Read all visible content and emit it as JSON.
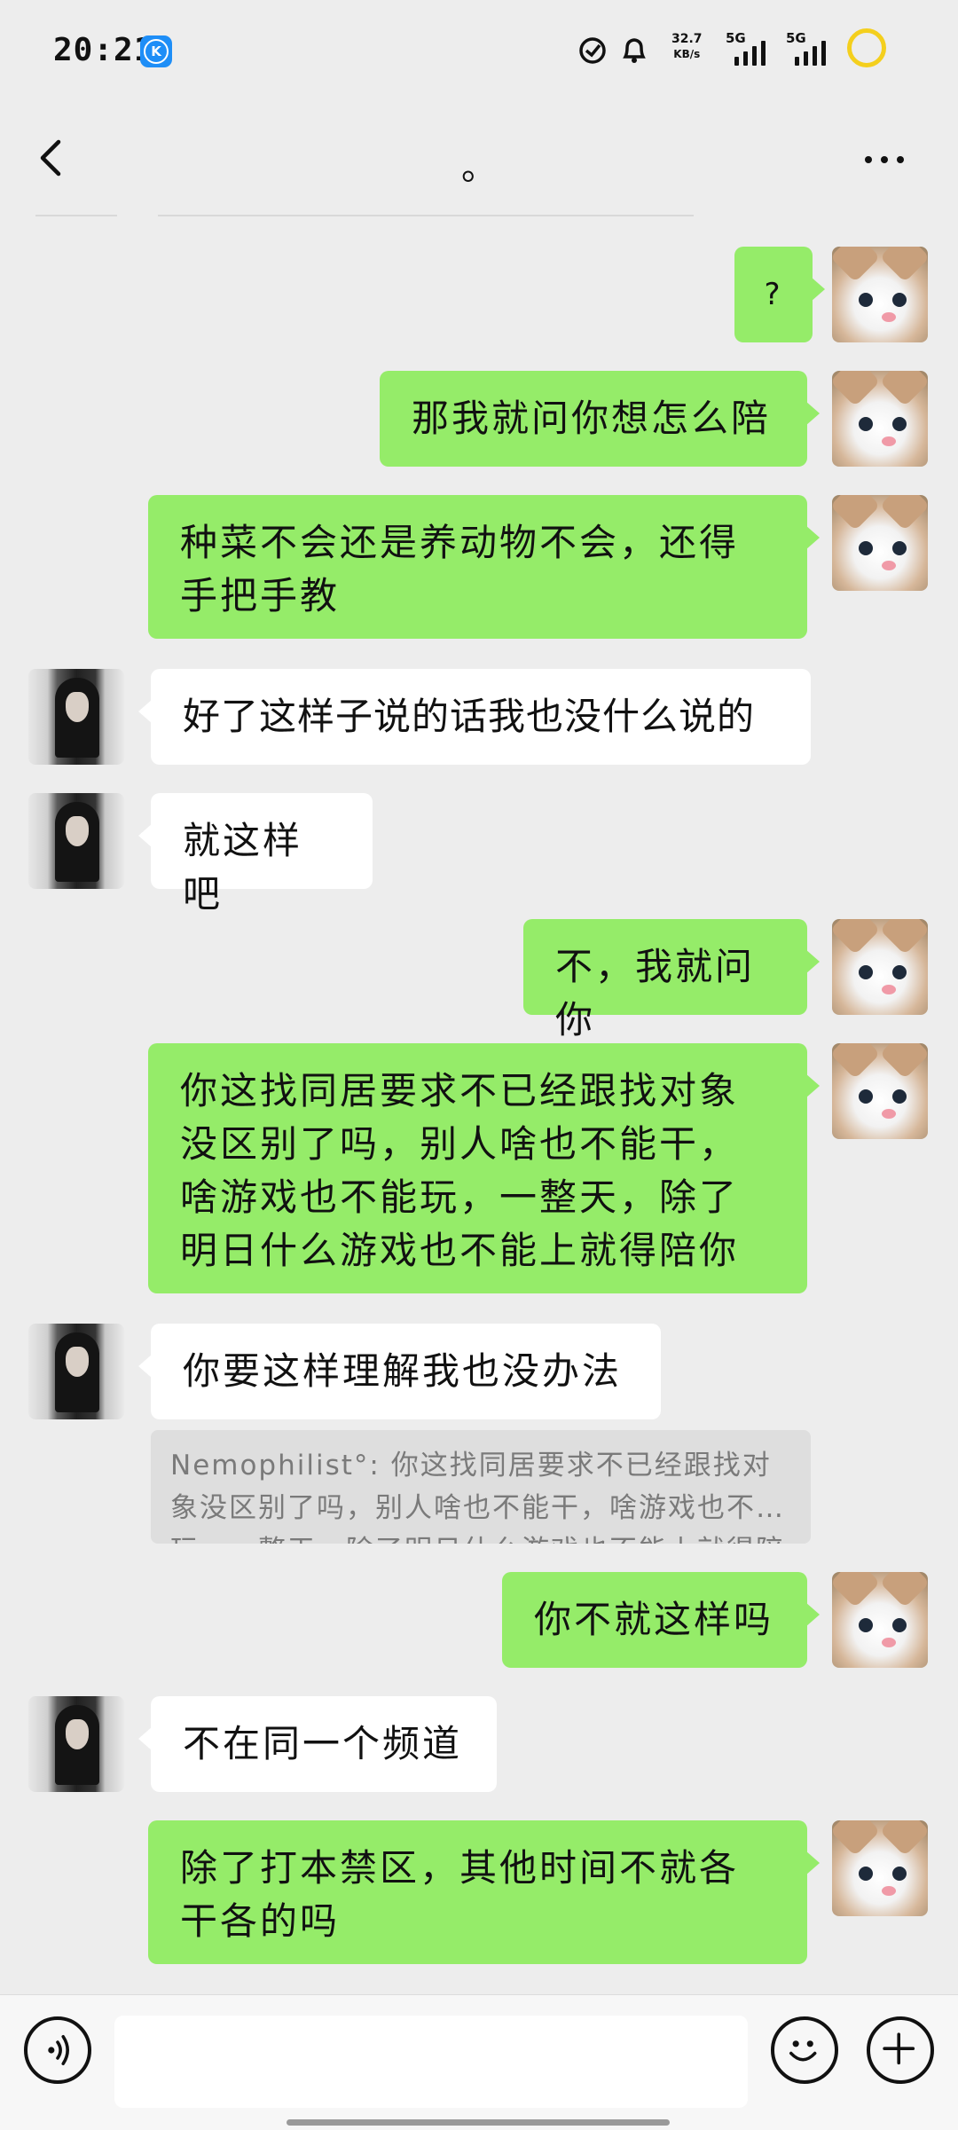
{
  "status_bar": {
    "time": "20:21",
    "app_badge": "K",
    "net_speed_value": "32.7",
    "net_speed_unit": "KB/s",
    "sim1_label": "5G",
    "sim2_label": "5G"
  },
  "header": {
    "title": "。"
  },
  "messages": [
    {
      "from": "self",
      "text": "?"
    },
    {
      "from": "self",
      "text": "那我就问你想怎么陪"
    },
    {
      "from": "self",
      "text": "种菜不会还是养动物不会，还得手把手教"
    },
    {
      "from": "other",
      "text": "好了这样子说的话我也没什么说的"
    },
    {
      "from": "other",
      "text": "就这样吧"
    },
    {
      "from": "self",
      "text": "不，我就问你"
    },
    {
      "from": "self",
      "text": "你这找同居要求不已经跟找对象没区别了吗，别人啥也不能干，啥游戏也不能玩，一整天，除了明日什么游戏也不能上就得陪你"
    },
    {
      "from": "other",
      "text": "你要这样理解我也没办法"
    },
    {
      "from": "self",
      "text": "你不就这样吗"
    },
    {
      "from": "other",
      "text": "不在同一个频道"
    },
    {
      "from": "self",
      "text": "除了打本禁区，其他时间不就各干各的吗"
    }
  ],
  "quote": {
    "text": "Nemophilist°: 你这找同居要求不已经跟找对象没区别了吗，别人啥也不能干，啥游戏也不能玩，一整天，除了明日什么游戏也不能上就得陪你"
  },
  "input_bar": {
    "placeholder": "",
    "voice_icon": "voice-icon",
    "emoji_icon": "emoji-icon",
    "plus_icon": "plus-icon"
  },
  "colors": {
    "self_bubble": "#95ec69",
    "other_bubble": "#ffffff",
    "background": "#ededed"
  }
}
